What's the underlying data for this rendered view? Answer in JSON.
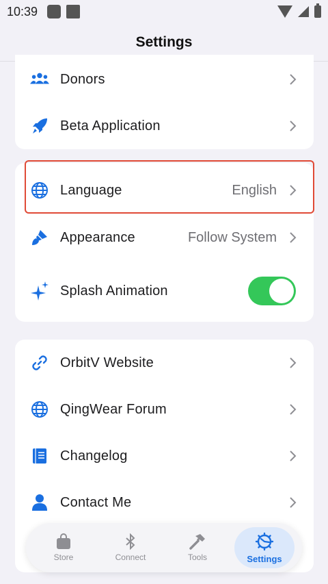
{
  "status_bar": {
    "time": "10:39"
  },
  "header": {
    "title": "Settings"
  },
  "groups": [
    {
      "rows": [
        {
          "label": "Donors",
          "icon": "people-icon"
        },
        {
          "label": "Beta Application",
          "icon": "rocket-icon"
        }
      ]
    },
    {
      "rows": [
        {
          "label": "Language",
          "value": "English",
          "icon": "globe-icon"
        },
        {
          "label": "Appearance",
          "value": "Follow System",
          "icon": "brush-icon"
        },
        {
          "label": "Splash Animation",
          "icon": "sparkle-icon",
          "toggle_on": true
        }
      ]
    },
    {
      "rows": [
        {
          "label": "OrbitV Website",
          "icon": "link-icon"
        },
        {
          "label": "QingWear Forum",
          "icon": "globe-icon"
        },
        {
          "label": "Changelog",
          "icon": "book-icon"
        },
        {
          "label": "Contact Me",
          "icon": "person-icon"
        }
      ]
    }
  ],
  "tabbar": {
    "tabs": [
      {
        "label": "Store",
        "icon": "bag-icon",
        "active": false
      },
      {
        "label": "Connect",
        "icon": "bluetooth-icon",
        "active": false
      },
      {
        "label": "Tools",
        "icon": "hammer-icon",
        "active": false
      },
      {
        "label": "Settings",
        "icon": "gear-icon",
        "active": true
      }
    ]
  },
  "colors": {
    "accent": "#1a6fe0",
    "toggle": "#34c759",
    "highlight": "#e04a36"
  }
}
